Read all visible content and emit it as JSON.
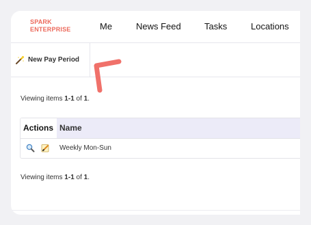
{
  "brand": {
    "line1": "SPARK",
    "line2": "ENTERPRISE",
    "color": "#ec6a5c"
  },
  "nav": {
    "items": [
      {
        "label": "Me"
      },
      {
        "label": "News Feed"
      },
      {
        "label": "Tasks"
      },
      {
        "label": "Locations"
      }
    ]
  },
  "toolbar": {
    "new_pay_period": {
      "label": "New Pay Period",
      "icon": "magic-wand-icon"
    }
  },
  "pagination": {
    "top": {
      "prefix": "Viewing items ",
      "range": "1-1",
      "middle": " of ",
      "total": "1",
      "suffix": "."
    },
    "bottom": {
      "prefix": "Viewing items ",
      "range": "1-1",
      "middle": " of ",
      "total": "1",
      "suffix": "."
    }
  },
  "table": {
    "columns": [
      "Actions",
      "Name"
    ],
    "header_bg": "#ecebf8",
    "rows": [
      {
        "actions": [
          "magnifier-icon",
          "edit-icon"
        ],
        "name": "Weekly Mon-Sun"
      }
    ]
  },
  "annotation": {
    "color": "#f0716a"
  }
}
